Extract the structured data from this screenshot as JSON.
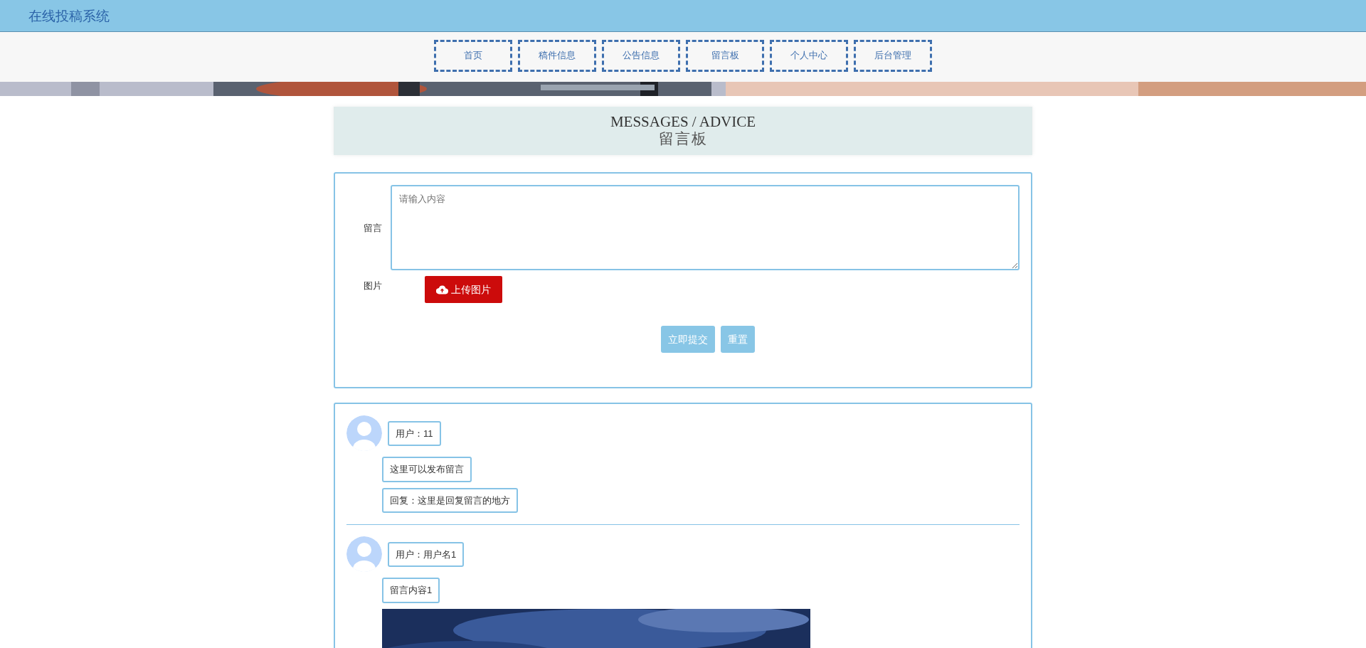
{
  "site_title": "在线投稿系统",
  "nav": [
    {
      "label": "首页"
    },
    {
      "label": "稿件信息"
    },
    {
      "label": "公告信息"
    },
    {
      "label": "留言板"
    },
    {
      "label": "个人中心"
    },
    {
      "label": "后台管理"
    }
  ],
  "heading": {
    "title": "MESSAGES / ADVICE",
    "subtitle": "留言板"
  },
  "form": {
    "message_label": "留言",
    "message_placeholder": "请输入内容",
    "image_label": "图片",
    "upload_button": "上传图片",
    "submit_button": "立即提交",
    "reset_button": "重置"
  },
  "messages": [
    {
      "user": "用户：11",
      "content": "这里可以发布留言",
      "reply": "回复：这里是回复留言的地方"
    },
    {
      "user": "用户：用户名1",
      "content": "留言内容1"
    }
  ]
}
